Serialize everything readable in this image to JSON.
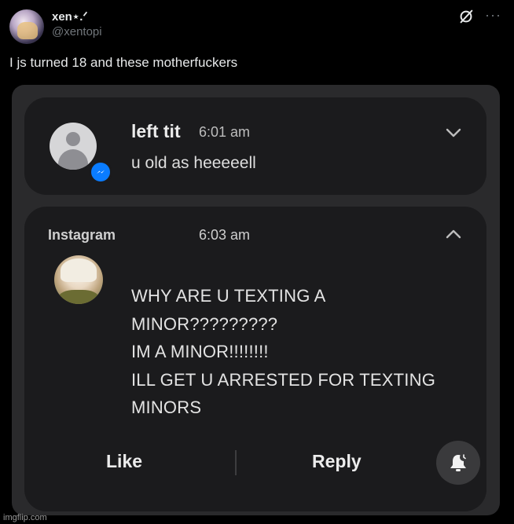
{
  "post": {
    "display_name": "xen⋆.ᐟ",
    "handle": "@xentopi",
    "text": "I js turned 18 and these motherfuckers",
    "icons": [
      "grok-icon",
      "more-icon"
    ],
    "more_glyph": "···"
  },
  "screenshot": {
    "notification1": {
      "sender": "left tit",
      "time": "6:01 am",
      "message": "u old as heeeeell",
      "badge_icon": "messenger-icon"
    },
    "notification2": {
      "app": "Instagram",
      "time": "6:03 am",
      "lines": [
        "WHY ARE U TEXTING A",
        "MINOR?????????",
        "IM A MINOR!!!!!!!!",
        "ILL GET U ARRESTED FOR TEXTING",
        "MINORS"
      ],
      "actions": {
        "like": "Like",
        "reply": "Reply",
        "mute_icon": "bell-snooze-icon"
      }
    }
  },
  "watermark": "imgflip.com",
  "colors": {
    "background": "#000000",
    "card": "#1b1b1d",
    "messenger_blue": "#0a7cff",
    "handle_gray": "#71767b"
  }
}
